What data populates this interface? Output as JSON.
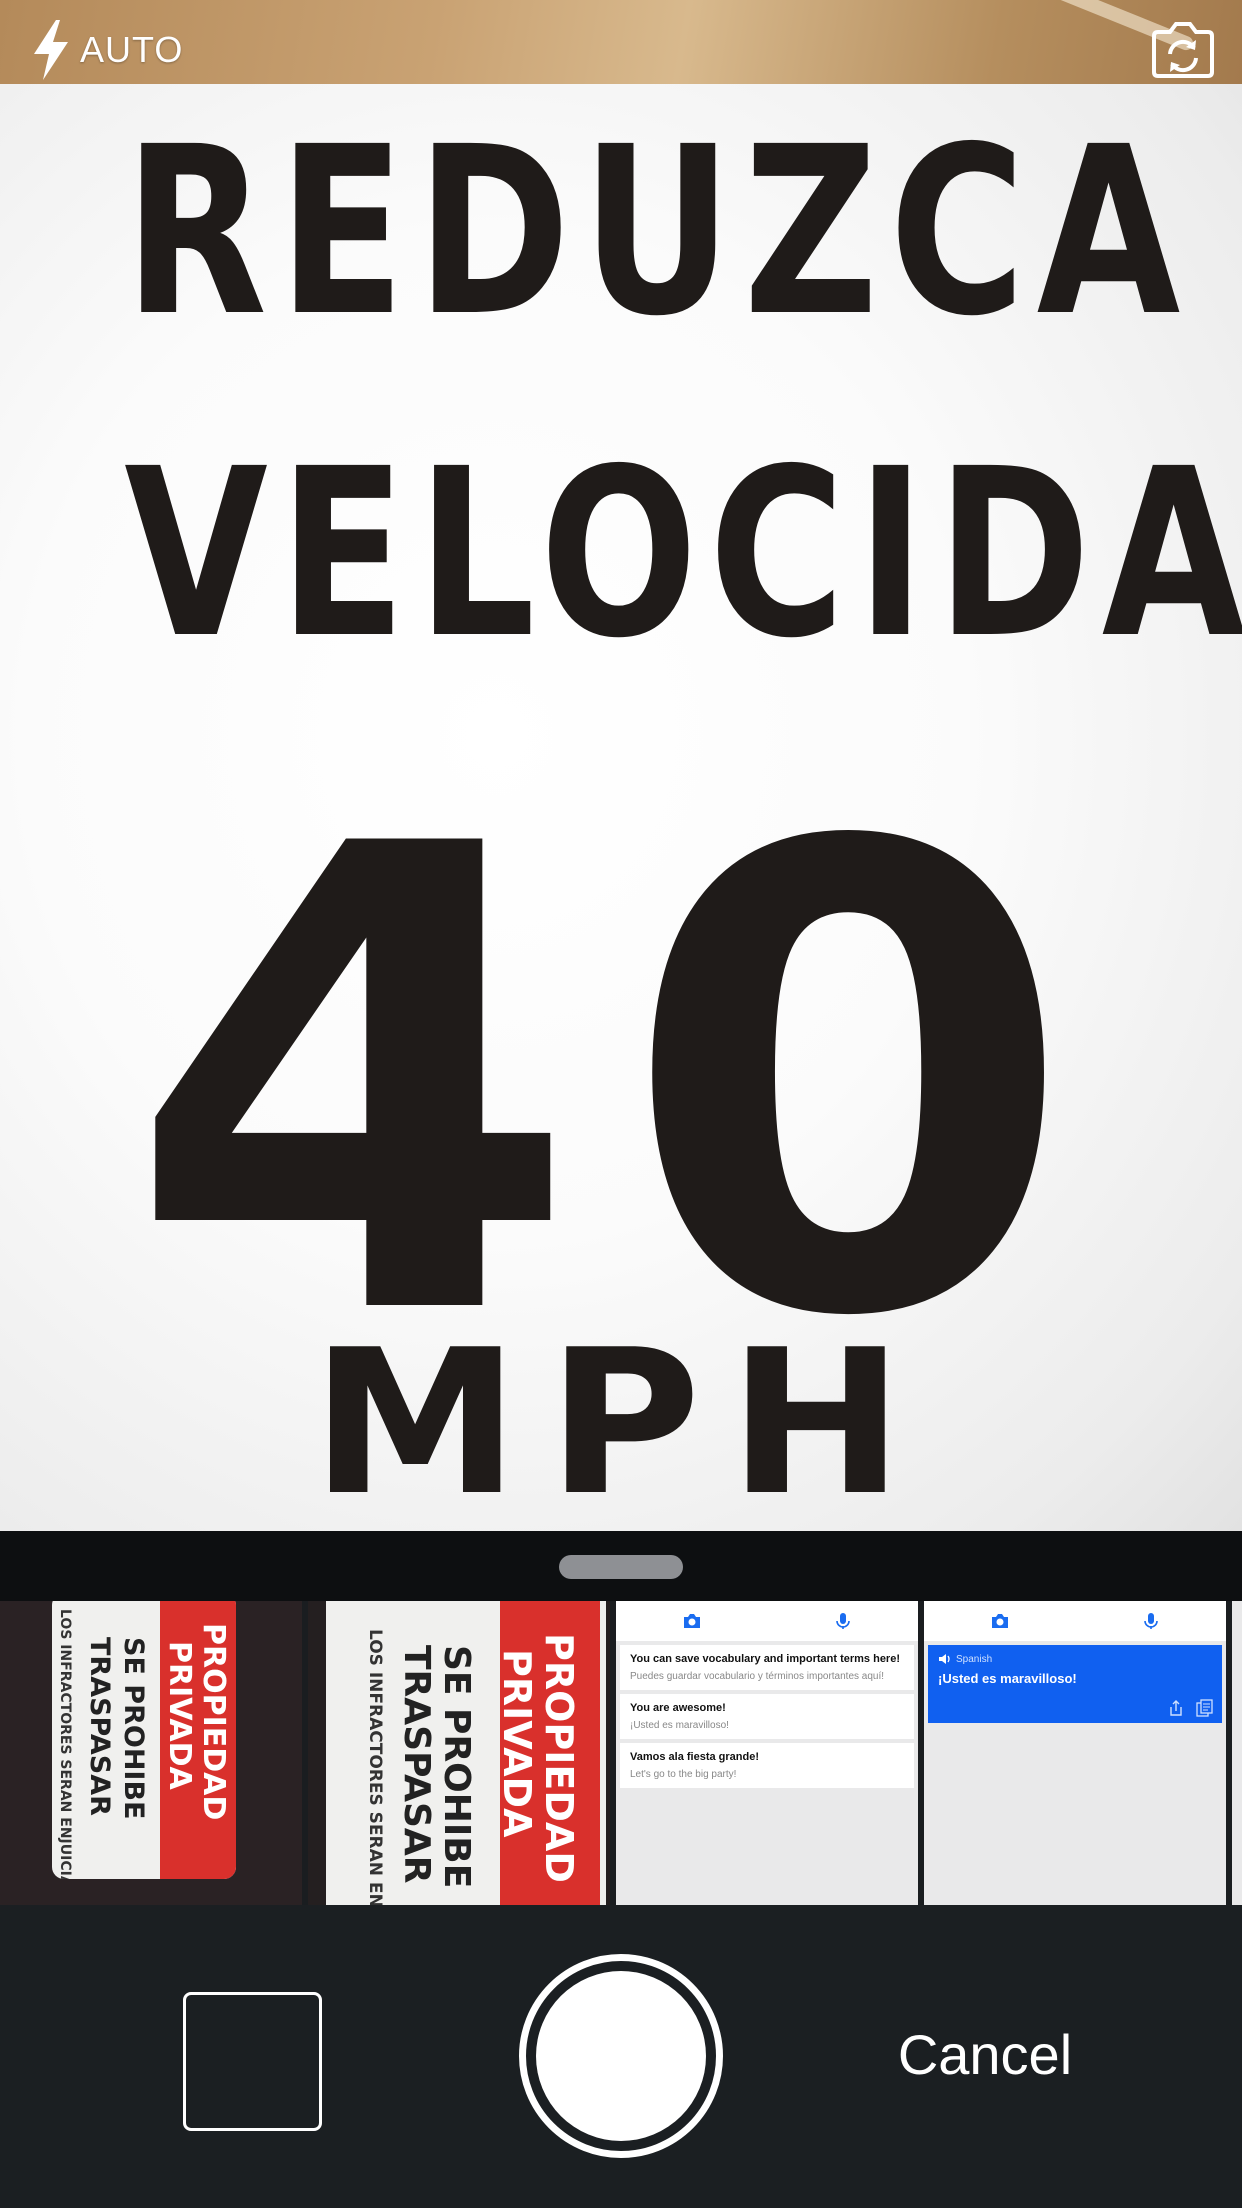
{
  "top_bar": {
    "flash_icon": "lightning-bolt-icon",
    "flash_label": "AUTO",
    "switch_camera_icon": "camera-rotate-icon"
  },
  "viewfinder": {
    "line1": "REDUZCA",
    "line2": "VELOCIDAD",
    "speed": "40",
    "unit": "MPH"
  },
  "recent_photos": [
    {
      "kind": "photo",
      "red_text_1": "PROPIEDAD",
      "red_text_2": "PRIVADA",
      "black_text_1": "SE PROHIBE",
      "black_text_2": "TRASPASAR",
      "small_text": "LOS INFRACTORES SERAN ENJUICIADOS"
    },
    {
      "kind": "photo",
      "red_text_1": "PROPIEDAD",
      "red_text_2": "PRIVADA",
      "black_text_1": "SE PROHIBE",
      "black_text_2": "TRASPASAR",
      "small_text": "LOS INFRACTORES SERAN ENJUICIADOS"
    },
    {
      "kind": "screenshot-list",
      "cards": [
        {
          "title": "You can save vocabulary and important terms here!",
          "subtitle": "Puedes guardar vocabulario y términos importantes aquí!"
        },
        {
          "title": "You are awesome!",
          "subtitle": "¡Usted es maravilloso!"
        },
        {
          "title": "Vamos ala fiesta grande!",
          "subtitle": "Let's go to the big party!"
        }
      ]
    },
    {
      "kind": "screenshot-translation",
      "language": "Spanish",
      "translation": "¡Usted es maravilloso!"
    }
  ],
  "controls": {
    "cancel_label": "Cancel"
  },
  "colors": {
    "sheet_dark": "#0d0f11",
    "controls_bg": "#1b1f22",
    "sign_red": "#d9302c",
    "app_blue": "#1060f0"
  }
}
